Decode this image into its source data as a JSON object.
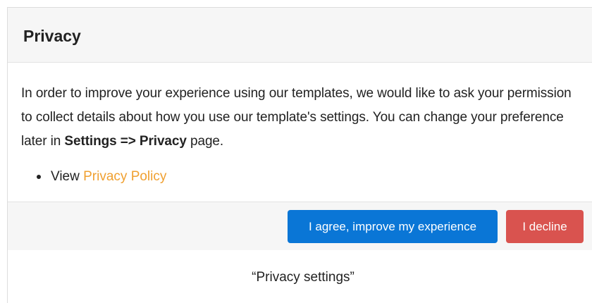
{
  "dialog": {
    "title": "Privacy",
    "body": {
      "text_part1": "In order to improve your experience using our templates, we would like to ask your permission to collect details about how you use our template's settings. You can change your preference later in ",
      "bold_path": "Settings => Privacy",
      "text_part2": " page.",
      "list": {
        "prefix": "View ",
        "link_label": "Privacy Policy"
      }
    },
    "footer": {
      "agree_label": "I agree, improve my experience",
      "decline_label": "I decline"
    }
  },
  "caption": "“Privacy settings”",
  "colors": {
    "link": "#f0a030",
    "agree_button": "#0a76d6",
    "decline_button": "#d9534f"
  }
}
